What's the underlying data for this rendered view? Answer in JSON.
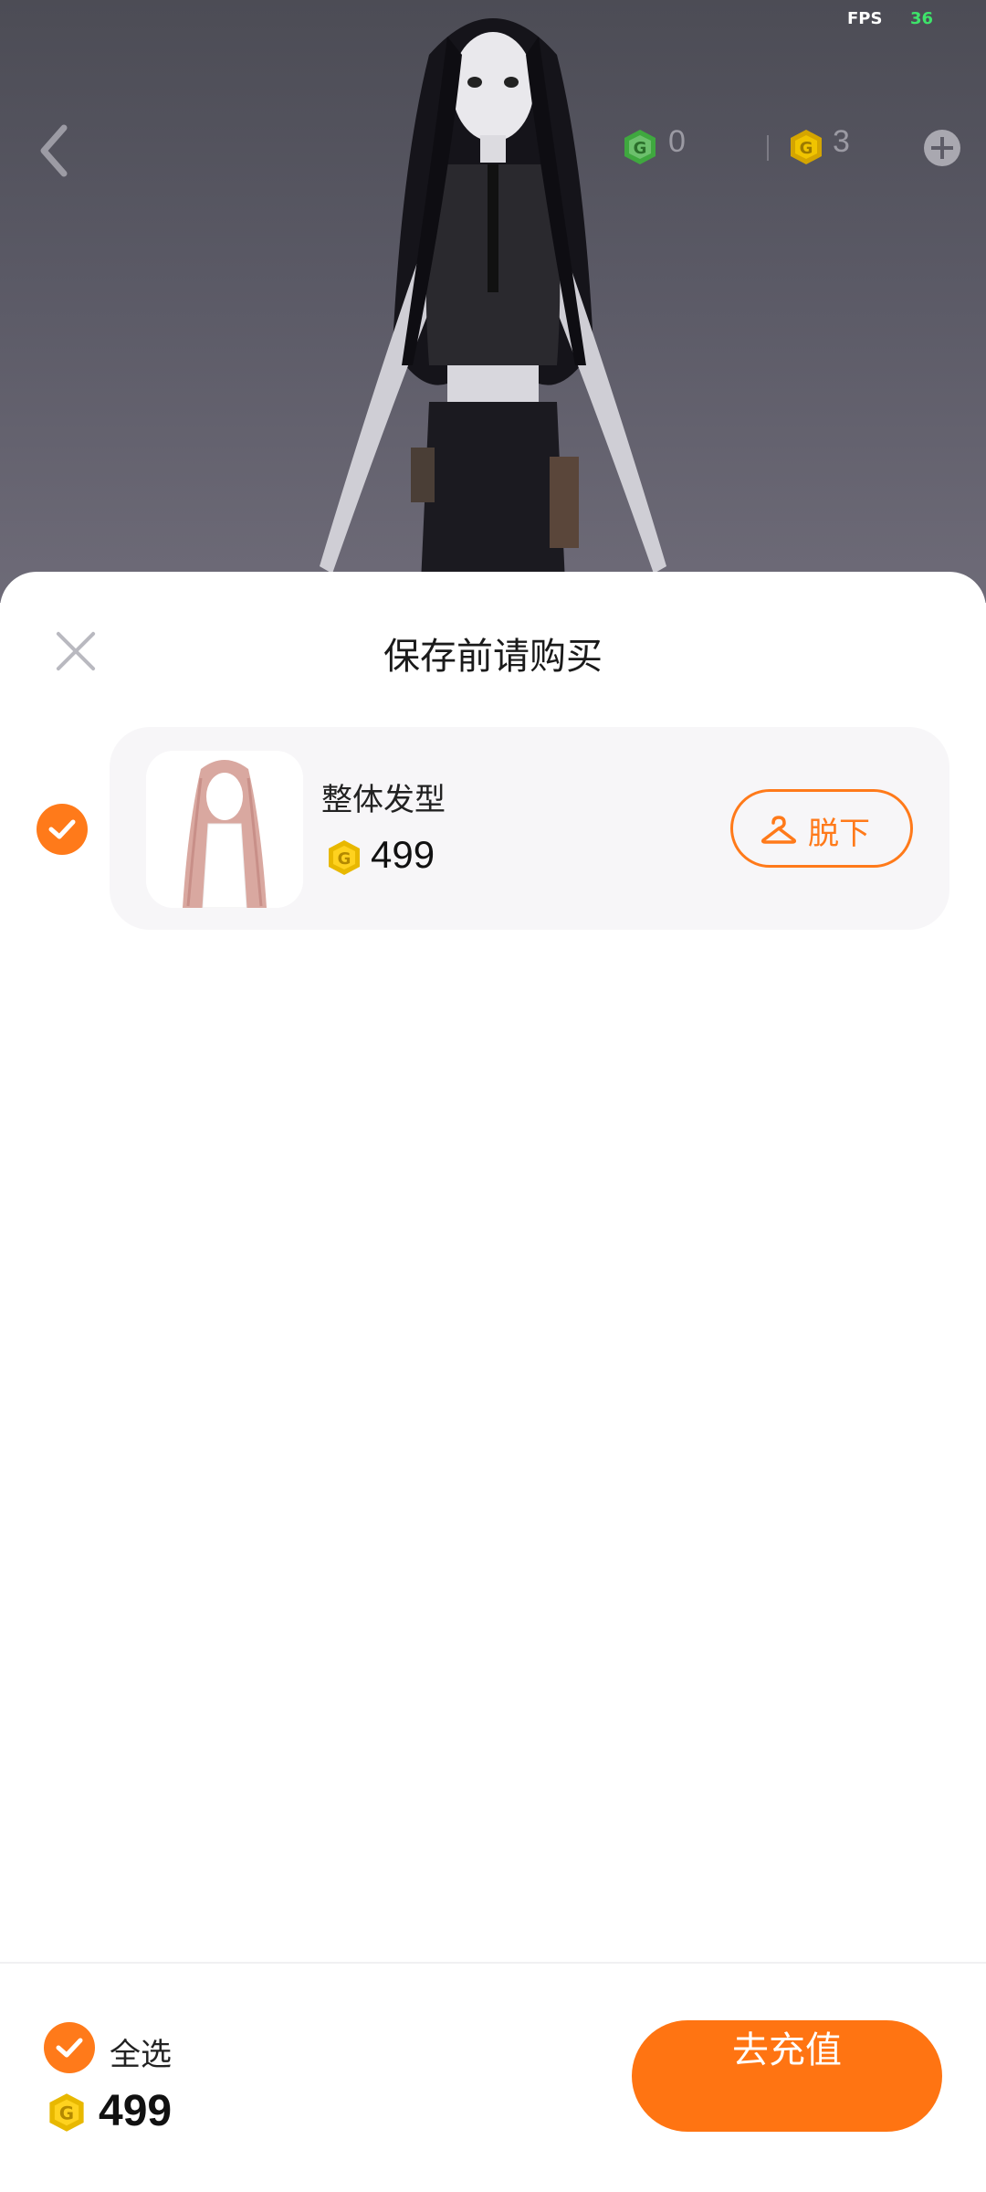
{
  "status": {
    "fps_label": "FPS",
    "fps_value": "36"
  },
  "top_bar": {
    "back_icon": "chevron-left-icon",
    "green_coin_balance": "0",
    "gold_coin_balance": "3",
    "add_icon": "plus-circle-icon"
  },
  "sheet": {
    "title": "保存前请购买",
    "items": [
      {
        "name": "整体发型",
        "price": "499",
        "selected": true,
        "action_label": "脱下",
        "action_icon": "hanger-icon"
      }
    ]
  },
  "footer": {
    "select_all_label": "全选",
    "select_all_checked": true,
    "total": "499",
    "recharge_label": "去充值"
  },
  "colors": {
    "accent": "#ff7a1a",
    "coin_gold": "#f5c400",
    "coin_green": "#3fa83f"
  }
}
